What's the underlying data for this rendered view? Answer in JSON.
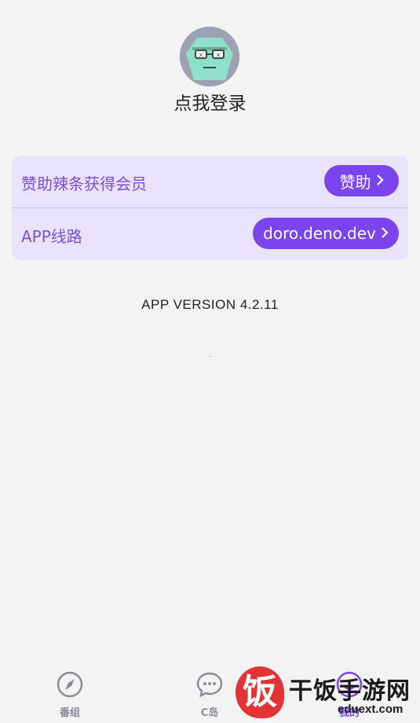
{
  "profile": {
    "login_text": "点我登录"
  },
  "settings": {
    "sponsor_row_label": "赞助辣条获得会员",
    "sponsor_button": "赞助",
    "route_row_label": "APP线路",
    "route_button": "doro.deno.dev"
  },
  "version_text": "APP VERSION 4.2.11",
  "tabbar": {
    "tabs": [
      {
        "label": "番组",
        "icon": "compass-icon"
      },
      {
        "label": "C岛",
        "icon": "chat-bubble-icon"
      },
      {
        "label": "我的",
        "icon": "profile-icon",
        "active": true
      }
    ]
  },
  "watermark": {
    "logo_char": "饭",
    "title": "干饭手游网",
    "url": "eduext.com"
  },
  "colors": {
    "accent": "#7a45ec",
    "card_bg": "#e8e2fa",
    "background": "#f3f3f4"
  }
}
